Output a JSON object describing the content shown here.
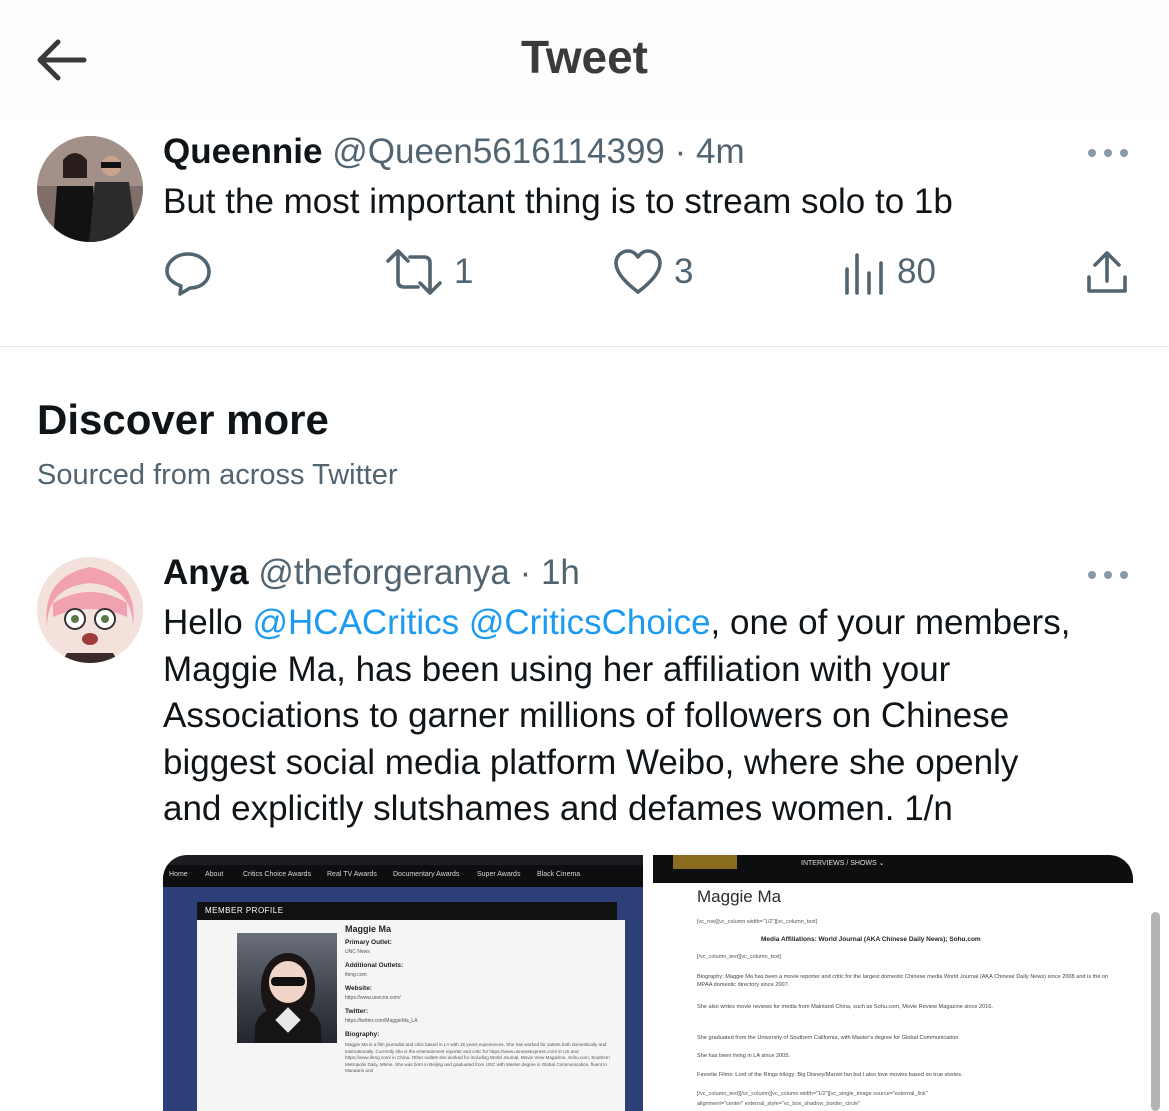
{
  "header": {
    "title": "Tweet",
    "back_icon": "back-arrow-icon"
  },
  "tweet": {
    "display_name": "Queennie",
    "handle": "@Queen5616114399",
    "time": "· 4m",
    "text": "But the most important thing is to stream solo to 1b",
    "actions": {
      "reply_count": "",
      "retweet_count": "1",
      "like_count": "3",
      "view_count": "80"
    }
  },
  "discover": {
    "title": "Discover more",
    "subtitle": "Sourced from across Twitter"
  },
  "post": {
    "display_name": "Anya",
    "handle": "@theforgeranya",
    "time": "· 1h",
    "greeting": "Hello ",
    "mention1": "@HCACritics",
    "space": " ",
    "mention2": "@CriticsChoice",
    "line1_rest": ", one of your members,",
    "line2": "Maggie Ma, has been using her affiliation with your",
    "line3": "Associations to garner millions of followers on Chinese",
    "line4": "biggest social media platform Weibo, where she openly",
    "line5": "and explicitly slutshames and defames women. 1/n"
  },
  "media_left": {
    "nav": [
      "Home",
      "About",
      "Critics Choice Awards",
      "Real TV Awards",
      "Documentary Awards",
      "Super Awards",
      "Black Cinema"
    ],
    "profile_header": "MEMBER PROFILE",
    "name": "Maggie Ma",
    "primary_outlet_label": "Primary Outlet:",
    "primary_outlet": "UNC News",
    "additional_label": "Additional Outlets:",
    "additional": "ifeng.com",
    "website_label": "Website:",
    "website": "https://www.unecne.com/",
    "twitter_label": "Twitter:",
    "twitter": "https://twitter.com/MaggieMa_LA",
    "bio_label": "Biography:",
    "bio": "Maggie Ma is a film journalist and critic based in LA with 15 years experiences. She has worked for outlets both domestically and internationally. Currently she is the entertainment reporter and critic for https://www.usnewsexpress.com/ in US and https://www.ifeng.com/ in China. Other outlets she worked for including World Journal, Movie View Magazine, Sohu.com, Southern Metropolis Daily, Mtime. She was born in Beijing and graduated from USC with Master degree in Global Communication, fluent in Mandarin and"
  },
  "media_right": {
    "nav": "INTERVIEWS / SHOWS ⌄",
    "title": "Maggie Ma",
    "code1": "[vc_row][vc_column width=\"1/2\"][vc_column_text]",
    "affiliations": "Media Affiliations: World Journal (AKA Chinese Daily News); Sohu.com",
    "code2": "[/vc_column_text][vc_column_text]",
    "biography": "Biography: Maggie Ma has been a movie reporter and critic for the largest domestic Chinese media World Journal (AKA Chinese Daily News) since 2008 and is the on MPAA domestic directory since 2007.",
    "reviews": "She also writes movie reviews for media from Mainland China, such as Sohu.com, Movie Review Magazine since 2016.",
    "graduated": "She graduated from the University of Southern California, with Master's degree for Global Communication.",
    "living": "She has been living in LA since 2005.",
    "favorite": "Favorite Films: Lord of the Rings trilogy; Big Disney/Marvel fan but I also love movies based on true stories.",
    "code3": "[/vc_column_text][/vc_column][vc_column width=\"1/2\"][vc_single_image source=\"external_link\"",
    "code4": "alignment=\"center\" external_style=\"vc_box_shadow_border_circle\""
  }
}
